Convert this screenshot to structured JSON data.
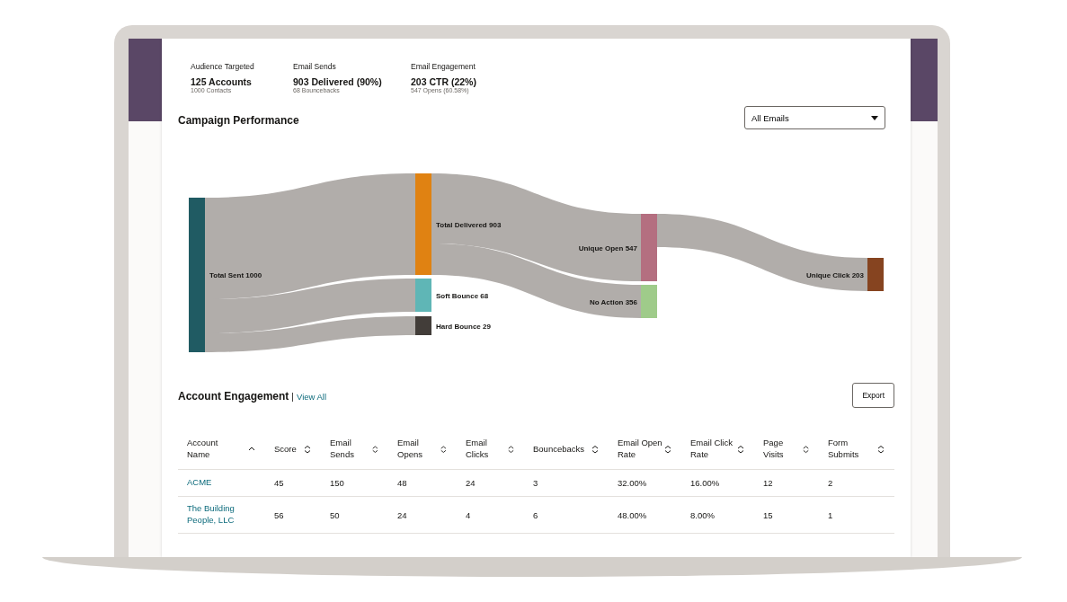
{
  "summary": [
    {
      "label": "Audience Targeted",
      "value": "125 Accounts",
      "detail": "1000 Contacts"
    },
    {
      "label": "Email Sends",
      "value": "903 Delivered (90%)",
      "detail": "68 Bouncebacks"
    },
    {
      "label": "Email Engagement",
      "value": "203 CTR (22%)",
      "detail": "547 Opens (60.58%)"
    }
  ],
  "campaign": {
    "title": "Campaign Performance",
    "filter": "All Emails",
    "nodes": [
      {
        "label": "Total Sent 1000",
        "color": "#205b63"
      },
      {
        "label": "Total Delivered 903",
        "color": "#e08212"
      },
      {
        "label": "Soft Bounce 68",
        "color": "#5fb6b6"
      },
      {
        "label": "Hard Bounce 29",
        "color": "#423d39"
      },
      {
        "label": "Unique Open 547",
        "color": "#b46f80"
      },
      {
        "label": "No Action 356",
        "color": "#9fcb8a"
      },
      {
        "label": "Unique Click 203",
        "color": "#864420"
      }
    ]
  },
  "engagement": {
    "title": "Account Engagement",
    "separator": "|",
    "link": "View All",
    "export": "Export",
    "columns": [
      {
        "label": "Account Name",
        "sorted": true
      },
      {
        "label": "Score",
        "sorted": false
      },
      {
        "label": "Email Sends",
        "sorted": false
      },
      {
        "label": "Email Opens",
        "sorted": false
      },
      {
        "label": "Email Clicks",
        "sorted": false
      },
      {
        "label": "Bouncebacks",
        "sorted": false
      },
      {
        "label": "Email Open Rate",
        "sorted": false
      },
      {
        "label": "Email Click Rate",
        "sorted": false
      },
      {
        "label": "Page Visits",
        "sorted": false
      },
      {
        "label": "Form Submits",
        "sorted": false
      }
    ],
    "rows": [
      [
        "ACME",
        "45",
        "150",
        "48",
        "24",
        "3",
        "32.00%",
        "16.00%",
        "12",
        "2"
      ],
      [
        "The Building People, LLC",
        "56",
        "50",
        "24",
        "4",
        "6",
        "48.00%",
        "8.00%",
        "15",
        "1"
      ]
    ]
  }
}
